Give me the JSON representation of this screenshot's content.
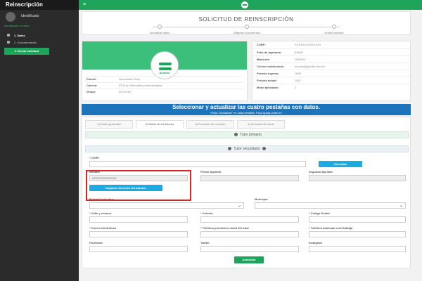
{
  "sidebar": {
    "brand": "Reinscripción",
    "user": "Identificado",
    "status": "Identificado en linea",
    "items": [
      {
        "label": "1. Datos",
        "active": true
      },
      {
        "label": "2. Documentación",
        "active": false
      }
    ],
    "send_button": "3. Enviar solicitud"
  },
  "stepper": {
    "title": "SOLICITUD DE REINSCRIPCIÓN",
    "steps": [
      "Actualizar datos",
      "Adjuntar documentos",
      "Enviar solicitud"
    ]
  },
  "profile": {
    "name": "Alumno",
    "rows": [
      {
        "k": "Plantel:",
        "v": "Hermosillo Cinco"
      },
      {
        "k": "Carrera:",
        "v": "PT-B en Informática Administrativa"
      },
      {
        "k": "Grupo:",
        "v": "502-4764"
      }
    ]
  },
  "info": {
    "rows": [
      {
        "k": "CURP:",
        "v": "XXXXXXXXXXXXXX"
      },
      {
        "k": "Folio de aspirante:",
        "v": "54638"
      },
      {
        "k": "Matrícula:",
        "v": "1860024"
      },
      {
        "k": "Correo institucional:",
        "v": "usuario@plantel.edu.mx"
      },
      {
        "k": "Periodo ingreso:",
        "v": "1805"
      },
      {
        "k": "Periodo actual:",
        "v": "1102"
      },
      {
        "k": "Modo aprobado:",
        "v": "1"
      }
    ]
  },
  "banner": {
    "title": "Seleccionar y actualizar las cuatro pestañas con datos.",
    "subtitle": "Pulsa \"Actualizar\" en cada pestaña. Para ayuda pulse en"
  },
  "tabs": [
    "1) Datos generales",
    "2) Datos de los tutores",
    "3) Encuesta de contexto",
    "4) Encuesta de salud"
  ],
  "tutor_primary": "Tutor primario",
  "tutor_secondary": "Tutor secundario",
  "form": {
    "curp_label": "* CURP",
    "consultar": "Consultar",
    "nombre_label": "Nombre",
    "nombre_value": "XXXXXXXXXXXXX",
    "primer_apellido": "Primer Apellido",
    "segundo_apellido": "Segundo Apellido",
    "duplicar": "Duplicar dirección del Alumno",
    "entidad": "Entidad federativa",
    "municipio": "Municipio",
    "calle": "* Calle y número",
    "colonia": "* Colonia",
    "codigo_postal": "* Código Postal",
    "correo": "* Correo electrónico",
    "telefono_movil": "* Teléfono personal o móvil del tutor",
    "telefono_adicional": "* Teléfono adicional o del trabajo",
    "facebook": "Facebook",
    "twitter": "Twitter",
    "instagram": "Instagram",
    "actualizar": "Actualizar"
  },
  "colors": {
    "green": "#1ea55b",
    "blue": "#1c75bc",
    "highlight": "#d22a2a"
  }
}
